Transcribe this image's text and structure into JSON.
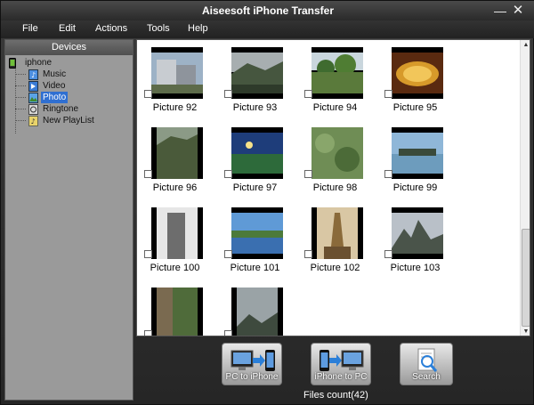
{
  "window": {
    "title": "Aiseesoft iPhone Transfer",
    "minimize_glyph": "—",
    "close_glyph": "✕"
  },
  "menu": {
    "items": [
      "File",
      "Edit",
      "Actions",
      "Tools",
      "Help"
    ]
  },
  "sidebar": {
    "header": "Devices",
    "device": "iphone",
    "items": [
      {
        "label": "Music",
        "icon": "music-icon",
        "selected": false
      },
      {
        "label": "Video",
        "icon": "video-icon",
        "selected": false
      },
      {
        "label": "Photo",
        "icon": "photo-icon",
        "selected": true
      },
      {
        "label": "Ringtone",
        "icon": "ringtone-icon",
        "selected": false
      },
      {
        "label": "New PlayList",
        "icon": "playlist-icon",
        "selected": false
      }
    ]
  },
  "photos": [
    {
      "caption": "Picture 92"
    },
    {
      "caption": "Picture 93"
    },
    {
      "caption": "Picture 94"
    },
    {
      "caption": "Picture 95"
    },
    {
      "caption": "Picture 96"
    },
    {
      "caption": "Picture 97"
    },
    {
      "caption": "Picture 98"
    },
    {
      "caption": "Picture 99"
    },
    {
      "caption": "Picture 100"
    },
    {
      "caption": "Picture 101"
    },
    {
      "caption": "Picture 102"
    },
    {
      "caption": "Picture 103"
    },
    {
      "caption": ""
    },
    {
      "caption": ""
    }
  ],
  "toolbar": {
    "pc_to_iphone": "PC to iPhone",
    "iphone_to_pc": "iPhone to PC",
    "search": "Search"
  },
  "status": {
    "files_count": "Files count(42)"
  },
  "colors": {
    "selection": "#2f6fd1",
    "sidebar_bg": "#9a9a9a",
    "window_bg": "#2b2b2b"
  }
}
